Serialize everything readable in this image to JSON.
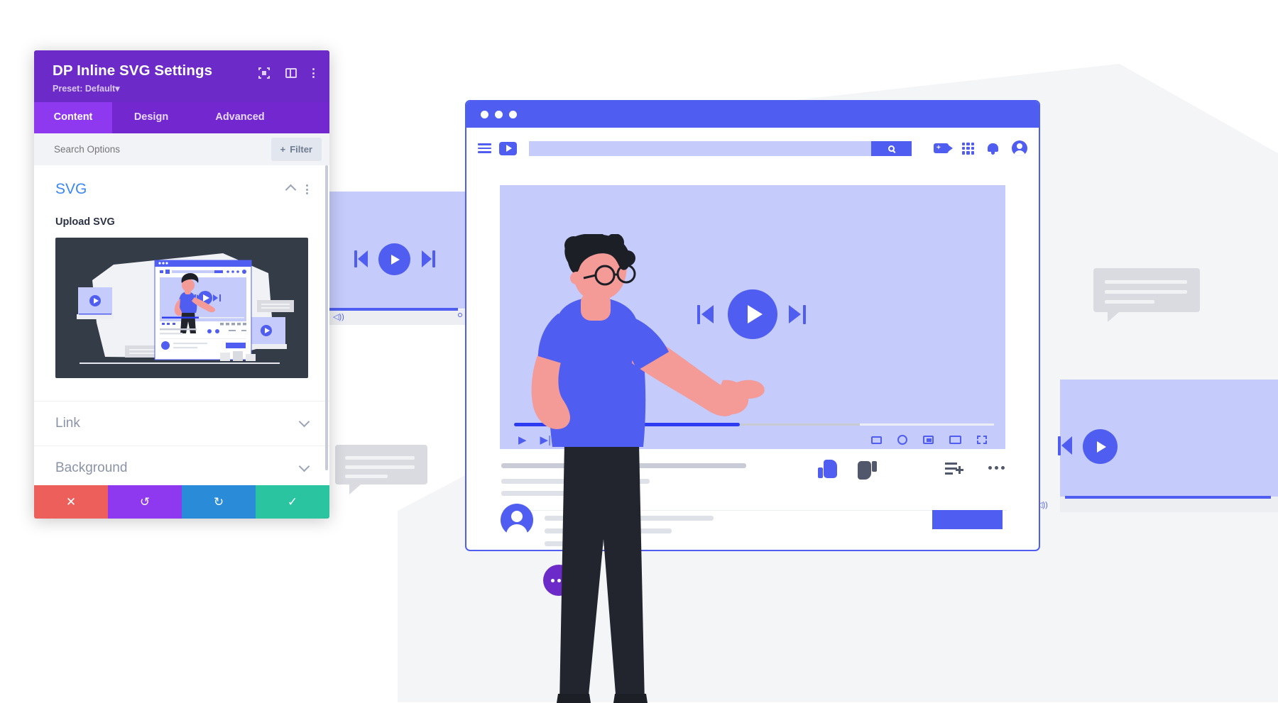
{
  "panel": {
    "title": "DP Inline SVG Settings",
    "preset_label": "Preset: Default",
    "preset_caret": "▾",
    "header_icons": [
      {
        "name": "focus-icon",
        "label": "focus"
      },
      {
        "name": "layout-icon",
        "label": "layout"
      },
      {
        "name": "more-options-icon",
        "label": "more"
      }
    ],
    "tabs": [
      {
        "label": "Content",
        "active": true
      },
      {
        "label": "Design",
        "active": false
      },
      {
        "label": "Advanced",
        "active": false
      }
    ],
    "search": {
      "placeholder": "Search Options",
      "value": ""
    },
    "filter_button": {
      "plus": "+",
      "label": "Filter"
    },
    "sections": [
      {
        "title": "SVG",
        "expanded": true,
        "upload_label": "Upload SVG",
        "preview_alt": "video player illustration preview"
      },
      {
        "title": "Link",
        "expanded": false
      },
      {
        "title": "Background",
        "expanded": false
      }
    ],
    "actions": [
      {
        "name": "cancel-button",
        "glyph": "✕",
        "color": "#ec5f5b"
      },
      {
        "name": "undo-button",
        "glyph": "↺",
        "color": "#8e38ef"
      },
      {
        "name": "redo-button",
        "glyph": "↻",
        "color": "#2a8bd8"
      },
      {
        "name": "save-button",
        "glyph": "✓",
        "color": "#2bc4a0"
      }
    ]
  },
  "mockup": {
    "browser": {
      "dots": 3,
      "toolbar": {
        "menu_icon": "hamburger-icon",
        "logo_icon": "play-logo-icon",
        "search_placeholder": "",
        "search_icon": "search-icon",
        "right_icons": [
          "video-add-icon",
          "apps-grid-icon",
          "notifications-bell-icon",
          "account-avatar-icon"
        ]
      },
      "player": {
        "center_play_icon": "play-icon",
        "prev_icon": "skip-previous-icon",
        "next_icon": "skip-next-icon",
        "progress_played_pct": 47,
        "progress_buffer_pct": 72,
        "controls_left": [
          "play-icon",
          "skip-next-icon",
          "volume-icon"
        ],
        "controls_right": [
          "captions-icon",
          "settings-gear-icon",
          "miniplayer-icon",
          "theater-icon",
          "fullscreen-icon"
        ]
      },
      "actions_row": {
        "like_icon": "thumb-up-icon",
        "dislike_icon": "thumb-down-icon",
        "save_icon": "add-to-playlist-icon",
        "more_icon": "more-horizontal-icon"
      },
      "channel": {
        "avatar_icon": "channel-avatar-icon",
        "subscribe_button_label": ""
      }
    },
    "floating_action": {
      "icon": "more-horizontal-icon"
    },
    "side_cards": [
      {
        "name": "left-player-card",
        "play_icon": "play-icon"
      },
      {
        "name": "right-player-card",
        "play_icon": "play-icon"
      }
    ],
    "speech_bubbles": [
      {
        "name": "left-speech-bubble"
      },
      {
        "name": "right-speech-bubble"
      }
    ]
  },
  "colors": {
    "panel_header": "#6c2bc8",
    "tab_active": "#8e38ef",
    "accent_blue": "#4f5ef0",
    "section_title": "#3b87f5",
    "preview_bg": "#343c48",
    "page_bg": "#f4f5f7"
  }
}
